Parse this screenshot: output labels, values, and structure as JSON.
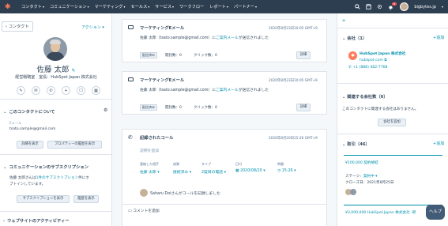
{
  "topnav": {
    "items": [
      "コンタクト",
      "コミュニケーション",
      "マーケティング",
      "セールス",
      "サービス",
      "ワークフロー",
      "レポート",
      "パートナー"
    ],
    "notification_count": "4",
    "account": "bigbytes.jp"
  },
  "left": {
    "back_label": "コンタクト",
    "actions_label": "アクション",
    "name": "佐藤 太郎",
    "subtitle": "経営戦略室　室長：HubSpot Japan 株式会社",
    "about_title": "このコンタクトについて",
    "email_label": "Eメール",
    "email_value": "tsato.sample@gmail.com",
    "view_details_btn": "詳細を表示",
    "property_history_btn": "プロパティーの履歴を表示",
    "subscription_title": "コミュニケーションのサブスクリプション",
    "subscription_text_1": "佐藤 太郎さんは",
    "subscription_link": "1件のサブスクリプション",
    "subscription_text_2": "件にオ",
    "subscription_text_3": "プトインしています。",
    "view_subscription_btn": "サブスクリプションを表示",
    "view_history_btn": "履歴を表示",
    "website_activity_title": "ウェブサイトのアクティビティー"
  },
  "center": {
    "email_cards": [
      {
        "title": "マーケティングEメール",
        "date": "2020年8月23日10:05 GMT+9",
        "text_prefix": "佐藤 太郎（tsato.sample@gmail.com）に",
        "link": "ご案内メール",
        "text_suffix": "が送信されました",
        "tag": "配信済み",
        "opens": "開封数：0",
        "clicks": "クリック数：0",
        "details_btn": "詳細"
      },
      {
        "title": "マーケティングEメール",
        "date": "2020年8月23日10:05 GMT+9",
        "text_prefix": "佐藤 太郎（tsato.sample@gmail.com）に",
        "link": "ご案内メール",
        "text_suffix": "が送信されました",
        "tag": "配信済み",
        "opens": "開封数：0",
        "clicks": "クリック数：0",
        "details_btn": "詳細"
      }
    ],
    "call": {
      "title": "記録されたコール",
      "date": "2020年8月20日15:26 GMT+9",
      "description_placeholder": "説明を追加",
      "fields": [
        {
          "label": "連絡した相手",
          "value": "佐藤 太郎"
        },
        {
          "label": "成果",
          "value": "接続済み"
        },
        {
          "label": "タイプ",
          "value": "2度目の電話"
        },
        {
          "label": "日付",
          "value": "2020/08/20"
        },
        {
          "label": "時間",
          "value": "15:26"
        }
      ],
      "logged_by": "Saharu Doiさんがコールを記録しました",
      "add_comment": "コメントを追加"
    }
  },
  "right": {
    "company_title": "会社（1）",
    "add_label": "+追加",
    "company_name": "HubSpot Japan 株式会社",
    "company_domain": "hubspot.com",
    "company_phone": "+1 (888) 482-7768",
    "related_companies_title": "関連する会社数（0）",
    "related_companies_text": "このコンタクトに関連する会社はありません。",
    "add_company_btn": "会社を追加",
    "deals_title": "取引（46）",
    "deals_add": "+追加",
    "deal1_title": "¥100,000 契約締結",
    "deal1_stage_label": "ステージ：",
    "deal1_stage_value": "契約中",
    "deal1_close": "クローズ日：2021年8月25日",
    "deal2_title": "¥3,000,000 HubSpot Japan 株式会社 -新"
  },
  "help_label": "ヘルプ",
  "colors": {
    "nav": "#2d3e50",
    "accent": "#ff7a59",
    "link": "#0091ae"
  }
}
